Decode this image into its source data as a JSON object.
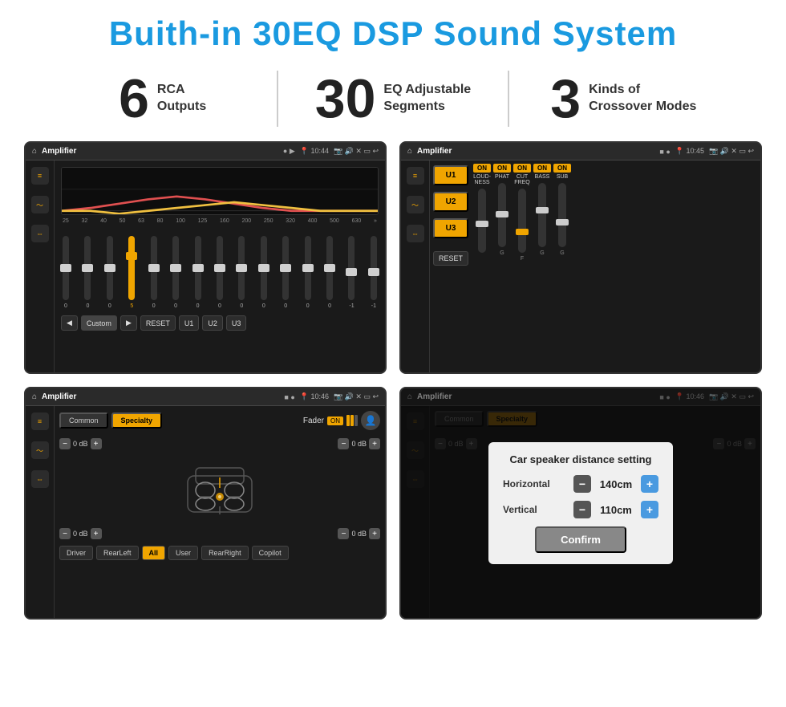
{
  "title": "Buith-in 30EQ DSP Sound System",
  "stats": [
    {
      "number": "6",
      "label": "RCA\nOutputs"
    },
    {
      "number": "30",
      "label": "EQ Adjustable\nSegments"
    },
    {
      "number": "3",
      "label": "Kinds of\nCrossover Modes"
    }
  ],
  "screens": [
    {
      "id": "eq-screen",
      "topbar": {
        "icon": "🏠",
        "title": "Amplifier",
        "time": "10:44"
      },
      "type": "eq",
      "freqs": [
        "25",
        "32",
        "40",
        "50",
        "63",
        "80",
        "100",
        "125",
        "160",
        "200",
        "250",
        "320",
        "400",
        "500",
        "630"
      ],
      "sliders": [
        {
          "val": "0",
          "pos": 50
        },
        {
          "val": "0",
          "pos": 50
        },
        {
          "val": "0",
          "pos": 50
        },
        {
          "val": "5",
          "pos": 35
        },
        {
          "val": "0",
          "pos": 50
        },
        {
          "val": "0",
          "pos": 50
        },
        {
          "val": "0",
          "pos": 50
        },
        {
          "val": "0",
          "pos": 50
        },
        {
          "val": "0",
          "pos": 50
        },
        {
          "val": "0",
          "pos": 50
        },
        {
          "val": "0",
          "pos": 50
        },
        {
          "val": "0",
          "pos": 50
        },
        {
          "val": "0",
          "pos": 50
        },
        {
          "val": "-1",
          "pos": 55
        },
        {
          "val": "-1",
          "pos": 55
        }
      ],
      "buttons": [
        "◀",
        "Custom",
        "▶",
        "RESET",
        "U1",
        "U2",
        "U3"
      ]
    },
    {
      "id": "crossover-screen",
      "topbar": {
        "icon": "🏠",
        "title": "Amplifier",
        "time": "10:45"
      },
      "type": "crossover",
      "uButtons": [
        "U1",
        "U2",
        "U3"
      ],
      "controls": [
        {
          "label": "LOUDNESS",
          "on": true
        },
        {
          "label": "PHAT",
          "on": true
        },
        {
          "label": "CUT FREQ",
          "on": true
        },
        {
          "label": "BASS",
          "on": true
        },
        {
          "label": "SUB",
          "on": true
        }
      ],
      "resetLabel": "RESET"
    },
    {
      "id": "fader-screen",
      "topbar": {
        "icon": "🏠",
        "title": "Amplifier",
        "time": "10:46"
      },
      "type": "fader",
      "tabs": [
        "Common",
        "Specialty"
      ],
      "faderLabel": "Fader",
      "onLabel": "ON",
      "channels": [
        {
          "label": "0 dB"
        },
        {
          "label": "0 dB"
        },
        {
          "label": "0 dB"
        },
        {
          "label": "0 dB"
        }
      ],
      "bottomBtns": [
        "Driver",
        "RearLeft",
        "All",
        "User",
        "RearRight",
        "Copilot"
      ]
    },
    {
      "id": "dialog-screen",
      "topbar": {
        "icon": "🏠",
        "title": "Amplifier",
        "time": "10:46"
      },
      "type": "dialog",
      "tabs": [
        "Common",
        "Specialty"
      ],
      "dialog": {
        "title": "Car speaker distance setting",
        "rows": [
          {
            "label": "Horizontal",
            "value": "140cm"
          },
          {
            "label": "Vertical",
            "value": "110cm"
          }
        ],
        "confirmLabel": "Confirm"
      }
    }
  ]
}
